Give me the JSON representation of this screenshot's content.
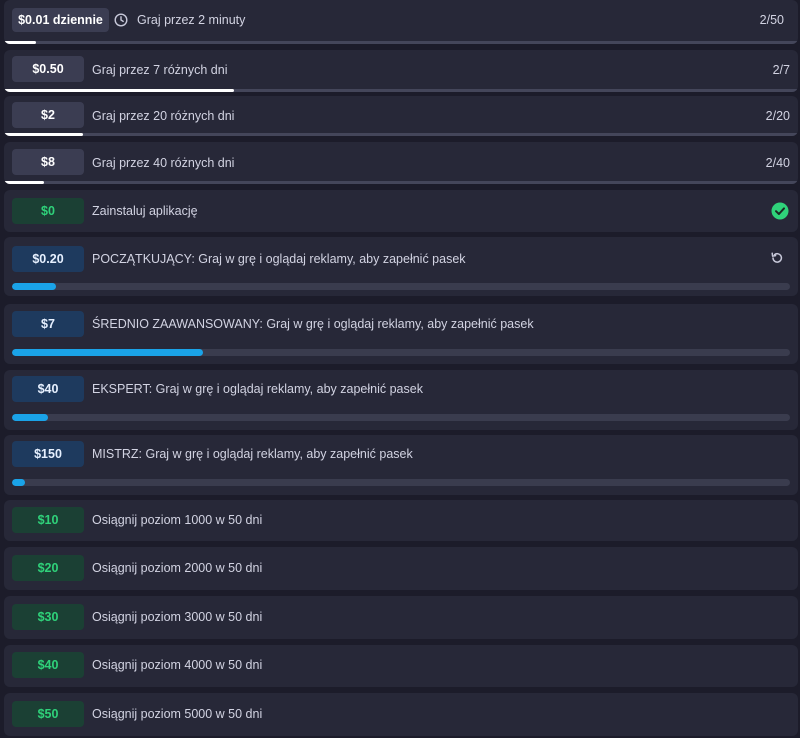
{
  "tasks": [
    {
      "reward": "$0.01 dziennie",
      "label": "Graj przez 2 minuty",
      "count": "2/50",
      "progress": 0.04
    },
    {
      "reward": "$0.50",
      "label": "Graj przez 7 różnych dni",
      "count": "2/7",
      "progress": 0.29
    },
    {
      "reward": "$2",
      "label": "Graj przez 20 różnych dni",
      "count": "2/20",
      "progress": 0.1
    },
    {
      "reward": "$8",
      "label": "Graj przez 40 różnych dni",
      "count": "2/40",
      "progress": 0.05
    }
  ],
  "install": {
    "reward": "$0",
    "label": "Zainstaluj aplikację",
    "status_icon": "check-circle-icon",
    "status_color": "#2fd27a"
  },
  "levels": [
    {
      "reward": "$0.20",
      "label": "POCZĄTKUJĄCY: Graj w grę i oglądaj reklamy, aby zapełnić pasek",
      "progress": 0.057,
      "icon": "refresh-icon"
    },
    {
      "reward": "$7",
      "label": "ŚREDNIO ZAAWANSOWANY: Graj w grę i oglądaj reklamy, aby zapełnić pasek",
      "progress": 0.245
    },
    {
      "reward": "$40",
      "label": "EKSPERT: Graj w grę i oglądaj reklamy, aby zapełnić pasek",
      "progress": 0.046
    },
    {
      "reward": "$150",
      "label": "MISTRZ: Graj w grę i oglądaj reklamy, aby zapełnić pasek",
      "progress": 0.017
    }
  ],
  "milestones": [
    {
      "reward": "$10",
      "label": "Osiągnij poziom 1000 w 50 dni"
    },
    {
      "reward": "$20",
      "label": "Osiągnij poziom 2000 w 50 dni"
    },
    {
      "reward": "$30",
      "label": "Osiągnij poziom 3000 w 50 dni"
    },
    {
      "reward": "$40",
      "label": "Osiągnij poziom 4000 w 50 dni"
    },
    {
      "reward": "$50",
      "label": "Osiągnij poziom 5000 w 50 dni"
    }
  ],
  "colors": {
    "accent_blue": "#1aa3e8",
    "reward_green": "#2fd27a",
    "background": "#1c1c2a",
    "row": "#272838"
  }
}
